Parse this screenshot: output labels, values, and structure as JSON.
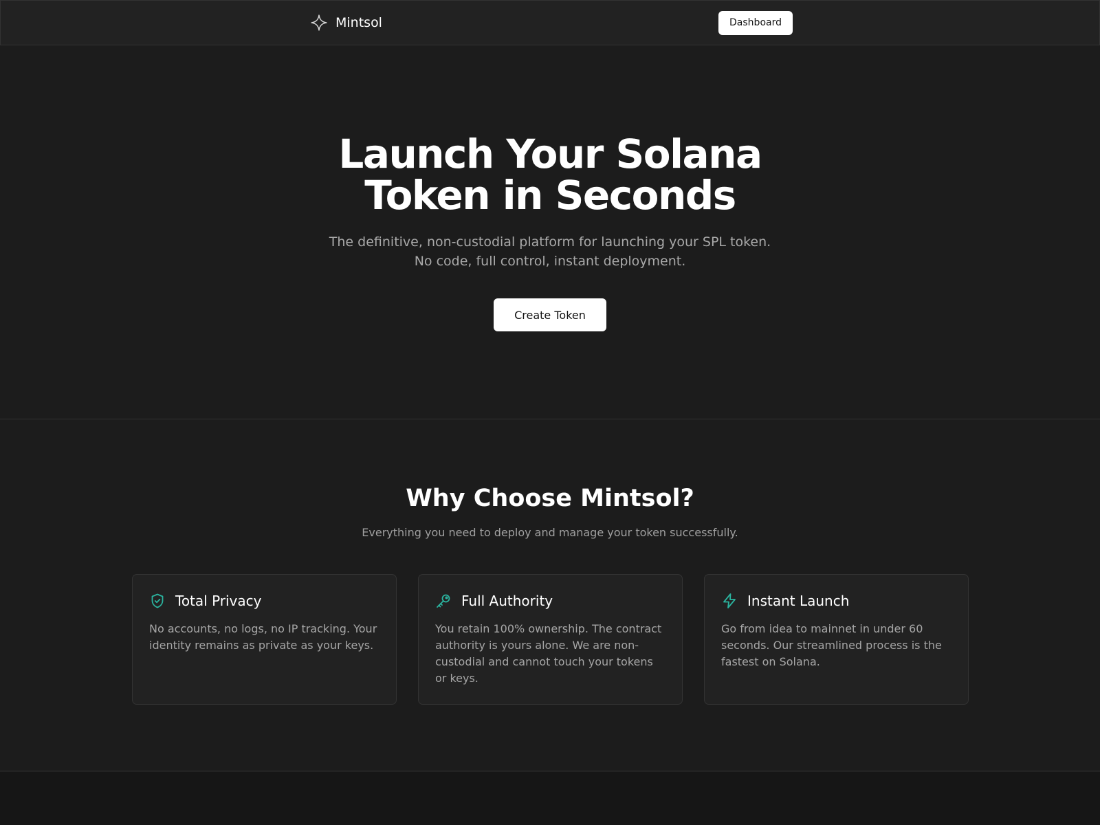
{
  "brand": {
    "name": "Mintsol",
    "icon": "sparkle-icon"
  },
  "nav": {
    "dashboard_label": "Dashboard"
  },
  "hero": {
    "title_line1": "Launch Your Solana",
    "title_line2": "Token in Seconds",
    "subtitle": "The definitive, non-custodial platform for launching your SPL token. No code, full control, instant deployment.",
    "cta_label": "Create Token"
  },
  "features": {
    "title": "Why Choose Mintsol?",
    "subtitle": "Everything you need to deploy and manage your token successfully.",
    "cards": [
      {
        "icon": "shield-check-icon",
        "title": "Total Privacy",
        "text": "No accounts, no logs, no IP tracking. Your identity remains as private as your keys."
      },
      {
        "icon": "key-icon",
        "title": "Full Authority",
        "text": "You retain 100% ownership. The contract authority is yours alone. We are non-custodial and cannot touch your tokens or keys."
      },
      {
        "icon": "lightning-icon",
        "title": "Instant Launch",
        "text": "Go from idea to mainnet in under 60 seconds. Our streamlined process is the fastest on Solana."
      }
    ]
  },
  "colors": {
    "background": "#1c1c1c",
    "navbar": "#222222",
    "accent": "#2bb5a0",
    "muted_text": "#a6a6a6"
  }
}
